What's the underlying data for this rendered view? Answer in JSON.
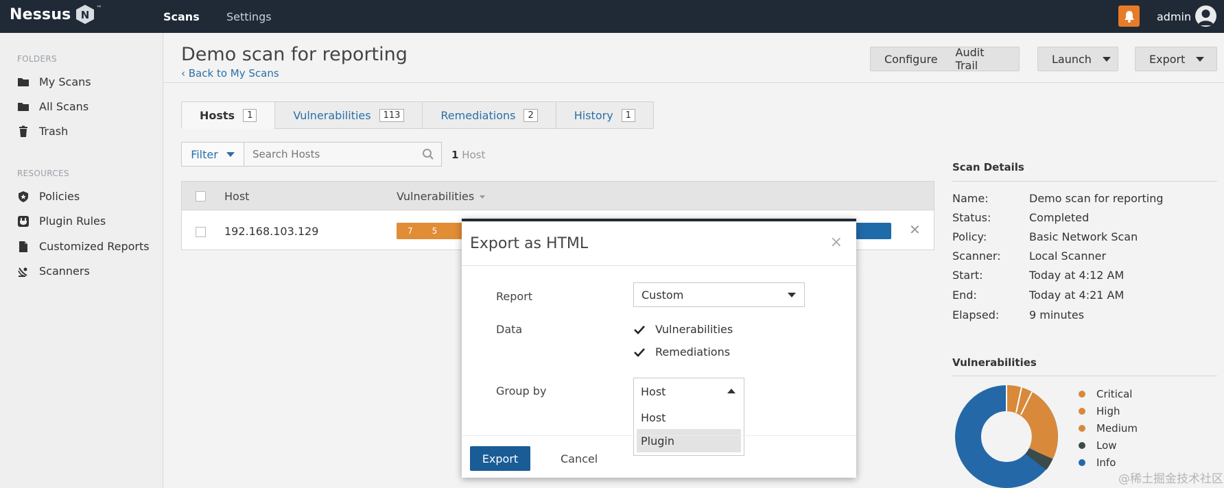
{
  "app": {
    "logo_text": "Nessus",
    "logo_letter": "N",
    "logo_tm": "™"
  },
  "topnav": {
    "scans": "Scans",
    "settings": "Settings",
    "user": "admin"
  },
  "sidebar": {
    "folders_label": "FOLDERS",
    "folders": [
      {
        "label": "My Scans",
        "icon": "folder-icon"
      },
      {
        "label": "All Scans",
        "icon": "folder-icon"
      },
      {
        "label": "Trash",
        "icon": "trash-icon"
      }
    ],
    "resources_label": "RESOURCES",
    "resources": [
      {
        "label": "Policies",
        "icon": "shield-icon"
      },
      {
        "label": "Plugin Rules",
        "icon": "plugin-icon"
      },
      {
        "label": "Customized Reports",
        "icon": "document-icon"
      },
      {
        "label": "Scanners",
        "icon": "satellite-icon"
      }
    ]
  },
  "header": {
    "title": "Demo scan for reporting",
    "back": "‹ Back to My Scans",
    "configure": "Configure",
    "audit_trail": "Audit Trail",
    "launch": "Launch",
    "export": "Export"
  },
  "tabs": [
    {
      "label": "Hosts",
      "count": "1"
    },
    {
      "label": "Vulnerabilities",
      "count": "113"
    },
    {
      "label": "Remediations",
      "count": "2"
    },
    {
      "label": "History",
      "count": "1"
    }
  ],
  "filter": {
    "label": "Filter",
    "search_placeholder": "Search Hosts",
    "count_num": "1",
    "count_word": "Host"
  },
  "table": {
    "col_host": "Host",
    "col_vulns": "Vulnerabilities",
    "rows": [
      {
        "host": "192.168.103.129",
        "critical": "7",
        "high": "5"
      }
    ]
  },
  "scan_details": {
    "title": "Scan Details",
    "rows": [
      {
        "k": "Name:",
        "v": "Demo scan for reporting"
      },
      {
        "k": "Status:",
        "v": "Completed"
      },
      {
        "k": "Policy:",
        "v": "Basic Network Scan"
      },
      {
        "k": "Scanner:",
        "v": "Local Scanner"
      },
      {
        "k": "Start:",
        "v": "Today at 4:12 AM"
      },
      {
        "k": "End:",
        "v": "Today at 4:21 AM"
      },
      {
        "k": "Elapsed:",
        "v": "9 minutes"
      }
    ]
  },
  "vulnerabilities": {
    "title": "Vulnerabilities",
    "legend": [
      {
        "label": "Critical",
        "color": "#d8893a"
      },
      {
        "label": "High",
        "color": "#d8893a"
      },
      {
        "label": "Medium",
        "color": "#d8893a"
      },
      {
        "label": "Low",
        "color": "#3b4a4a"
      },
      {
        "label": "Info",
        "color": "#2468a8"
      }
    ]
  },
  "modal": {
    "title": "Export as HTML",
    "close": "×",
    "report_label": "Report",
    "report_value": "Custom",
    "data_label": "Data",
    "data_options": [
      {
        "label": "Vulnerabilities",
        "checked": true
      },
      {
        "label": "Remediations",
        "checked": true
      }
    ],
    "group_label": "Group by",
    "group_value": "Host",
    "group_options": [
      "Host",
      "Plugin"
    ],
    "export_btn": "Export",
    "cancel_btn": "Cancel"
  },
  "watermark": "@稀土掘金技术社区",
  "colors": {
    "topbar": "#1f2a36",
    "link": "#2a6fa8",
    "accent_orange": "#e67c27",
    "primary_btn": "#1a5c96"
  }
}
